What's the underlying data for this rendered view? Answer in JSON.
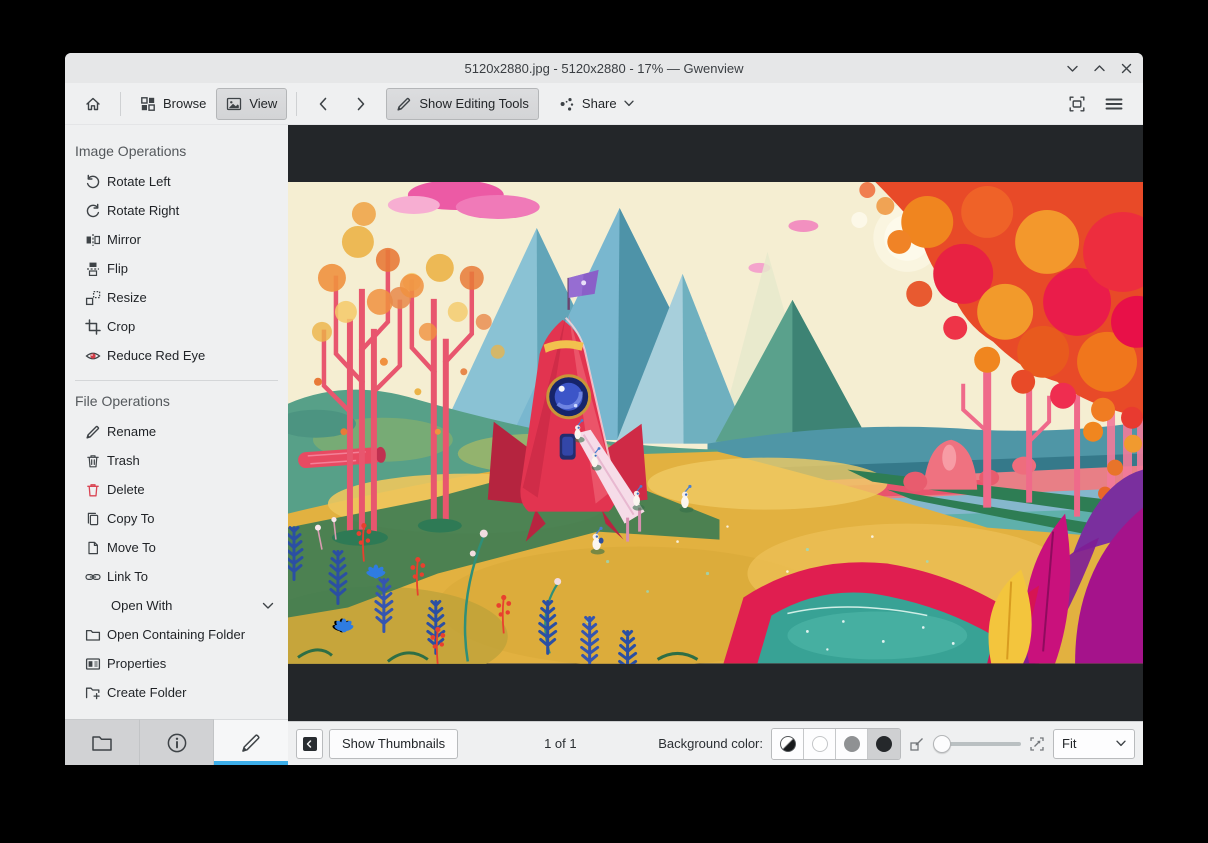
{
  "window": {
    "title": "5120x2880.jpg - 5120x2880 - 17% — Gwenview"
  },
  "toolbar": {
    "browse": "Browse",
    "view": "View",
    "show_editing_tools": "Show Editing Tools",
    "share": "Share"
  },
  "sidebar": {
    "image_operations": {
      "title": "Image Operations",
      "items": [
        {
          "label": "Rotate Left",
          "icon": "rotate-left-icon"
        },
        {
          "label": "Rotate Right",
          "icon": "rotate-right-icon"
        },
        {
          "label": "Mirror",
          "icon": "mirror-icon"
        },
        {
          "label": "Flip",
          "icon": "flip-icon"
        },
        {
          "label": "Resize",
          "icon": "resize-icon"
        },
        {
          "label": "Crop",
          "icon": "crop-icon"
        },
        {
          "label": "Reduce Red Eye",
          "icon": "red-eye-icon"
        }
      ]
    },
    "file_operations": {
      "title": "File Operations",
      "items": [
        {
          "label": "Rename",
          "icon": "rename-icon"
        },
        {
          "label": "Trash",
          "icon": "trash-icon"
        },
        {
          "label": "Delete",
          "icon": "delete-icon"
        },
        {
          "label": "Copy To",
          "icon": "copy-icon"
        },
        {
          "label": "Move To",
          "icon": "move-icon"
        },
        {
          "label": "Link To",
          "icon": "link-icon"
        },
        {
          "label": "Open With",
          "icon": "none",
          "has_submenu": true
        },
        {
          "label": "Open Containing Folder",
          "icon": "folder-open-icon"
        },
        {
          "label": "Properties",
          "icon": "properties-icon"
        },
        {
          "label": "Create Folder",
          "icon": "create-folder-icon"
        }
      ]
    }
  },
  "statusbar": {
    "show_thumbnails": "Show Thumbnails",
    "position": "1 of 1",
    "background_color_label": "Background color:",
    "zoom_mode": "Fit"
  },
  "colors": {
    "accent": "#3daee9",
    "viewer_background": "#232629",
    "delete_red": "#da4453"
  }
}
